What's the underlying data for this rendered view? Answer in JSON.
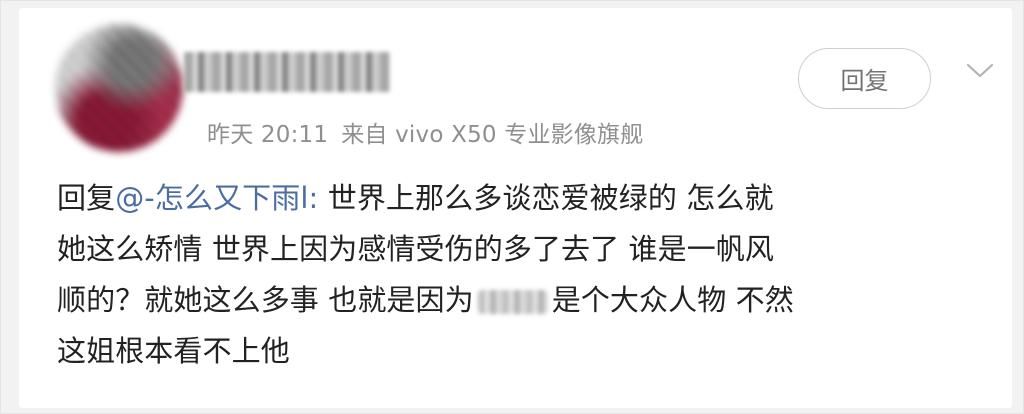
{
  "post": {
    "meta": {
      "time": "昨天 20:11",
      "source": "来自 vivo X50 专业影像旗舰"
    },
    "reply_button_label": "回复",
    "body": {
      "line1_prefix": "回复",
      "mention": "@-怎么又下雨l:",
      "line1_text": " 世界上那么多谈恋爱被绿的 怎么就",
      "line2": "她这么矫情 世界上因为感情受伤的多了去了 谁是一帆风",
      "line3_before": "顺的？就她这么多事 也就是因为",
      "line3_after": "是个大众人物 不然",
      "line4": "这姐根本看不上他"
    },
    "icons": {
      "chevron": "chevron-down-icon"
    }
  }
}
